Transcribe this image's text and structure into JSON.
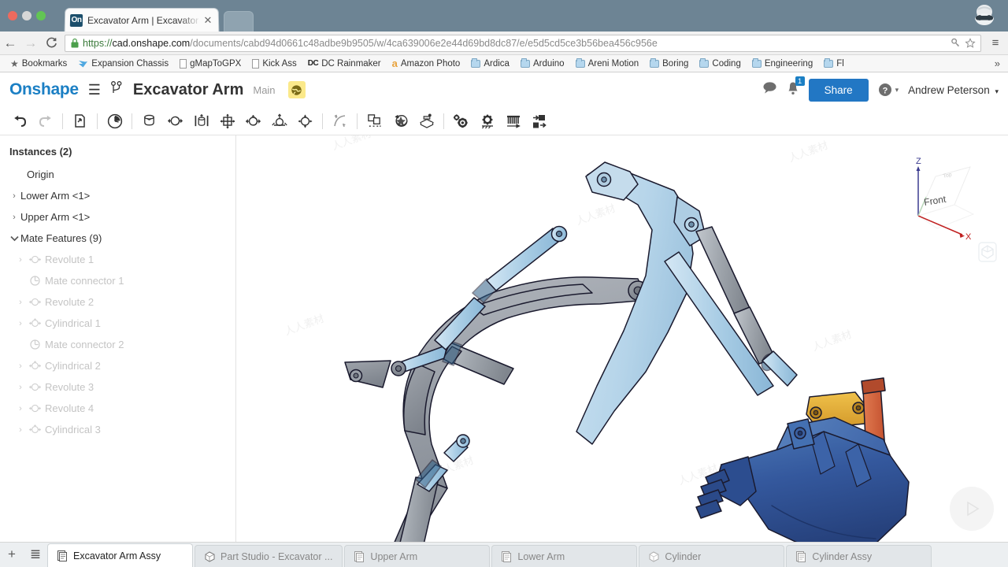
{
  "browser": {
    "tab_title": "Excavator Arm | Excavator",
    "tab_favicon_text": "On",
    "url_scheme": "https://",
    "url_host": "cad.onshape.com",
    "url_path": "/documents/cabd94d0661c48adbe9b9505/w/4ca639006e2e44d69bd8dc87/e/e5d5cd5ce3b56bea456c956e",
    "back_label": "←",
    "forward_label": "→",
    "reload_label": "C",
    "menu_label": "≡",
    "overflow_label": "»",
    "bookmarks": [
      {
        "label": "Bookmarks",
        "icon": "star-icon"
      },
      {
        "label": "Expansion Chassis",
        "icon": "bird-icon"
      },
      {
        "label": "gMapToGPX",
        "icon": "page-icon"
      },
      {
        "label": "Kick Ass",
        "icon": "page-icon"
      },
      {
        "label": "DC Rainmaker",
        "icon": "dc-icon"
      },
      {
        "label": "Amazon Photo",
        "icon": "amazon-icon"
      },
      {
        "label": "Ardica",
        "icon": "folder-icon"
      },
      {
        "label": "Arduino",
        "icon": "folder-icon"
      },
      {
        "label": "Areni Motion",
        "icon": "folder-icon"
      },
      {
        "label": "Boring",
        "icon": "folder-icon"
      },
      {
        "label": "Coding",
        "icon": "folder-icon"
      },
      {
        "label": "Engineering",
        "icon": "folder-icon"
      },
      {
        "label": "Fl",
        "icon": "folder-icon"
      }
    ]
  },
  "header": {
    "logo": "Onshape",
    "document_title": "Excavator Arm",
    "workspace": "Main",
    "share_label": "Share",
    "user_name": "Andrew Peterson",
    "notification_count": "1",
    "help_label": "?",
    "caret": "▾"
  },
  "toolbar": {
    "items": [
      {
        "name": "undo-icon",
        "label": "Undo",
        "disabled": false
      },
      {
        "name": "redo-icon",
        "label": "Redo",
        "disabled": true
      },
      {
        "name": "insert-part-icon",
        "label": "Insert components"
      },
      {
        "name": "assembly-history-icon",
        "label": "Assembly pattern"
      },
      {
        "name": "fastened-mate-icon",
        "label": "Fastened mate"
      },
      {
        "name": "revolute-mate-icon",
        "label": "Revolute mate"
      },
      {
        "name": "slider-mate-icon",
        "label": "Slider mate"
      },
      {
        "name": "planar-mate-icon",
        "label": "Planar mate"
      },
      {
        "name": "cylindrical-mate-icon",
        "label": "Cylindrical mate"
      },
      {
        "name": "pin-slot-mate-icon",
        "label": "Pin slot mate"
      },
      {
        "name": "ball-mate-icon",
        "label": "Ball mate"
      },
      {
        "name": "mate-relation-icon",
        "label": "Mate relation"
      },
      {
        "name": "group-icon",
        "label": "Group"
      },
      {
        "name": "replicate-icon",
        "label": "Replicate"
      },
      {
        "name": "explode-icon",
        "label": "Explode view"
      },
      {
        "name": "gear-mate-icon",
        "label": "Gear relation"
      },
      {
        "name": "mate-connector-icon",
        "label": "Mate connector"
      },
      {
        "name": "comb-icon",
        "label": "Linear pattern"
      },
      {
        "name": "insert-export-icon",
        "label": "Transform"
      }
    ]
  },
  "sidebar": {
    "heading": "Instances (2)",
    "rows": [
      {
        "label": "Origin",
        "indent": 3,
        "caret": "",
        "icon": "",
        "faded": false
      },
      {
        "label": "Lower Arm <1>",
        "indent": 1,
        "caret": "›",
        "icon": "",
        "faded": false
      },
      {
        "label": "Upper Arm <1>",
        "indent": 1,
        "caret": "›",
        "icon": "",
        "faded": false
      },
      {
        "label": "Mate Features (9)",
        "indent": 1,
        "caret": "⌄",
        "icon": "",
        "faded": false
      },
      {
        "label": "Revolute 1",
        "indent": 2,
        "caret": "›",
        "icon": "revolute-mate-icon",
        "faded": true
      },
      {
        "label": "Mate connector 1",
        "indent": 2,
        "caret": "",
        "icon": "mate-connector-icon",
        "faded": true
      },
      {
        "label": "Revolute 2",
        "indent": 2,
        "caret": "›",
        "icon": "revolute-mate-icon",
        "faded": true
      },
      {
        "label": "Cylindrical 1",
        "indent": 2,
        "caret": "›",
        "icon": "cylindrical-mate-icon",
        "faded": true
      },
      {
        "label": "Mate connector 2",
        "indent": 2,
        "caret": "",
        "icon": "mate-connector-icon",
        "faded": true
      },
      {
        "label": "Cylindrical 2",
        "indent": 2,
        "caret": "›",
        "icon": "cylindrical-mate-icon",
        "faded": true
      },
      {
        "label": "Revolute 3",
        "indent": 2,
        "caret": "›",
        "icon": "revolute-mate-icon",
        "faded": true
      },
      {
        "label": "Revolute 4",
        "indent": 2,
        "caret": "›",
        "icon": "revolute-mate-icon",
        "faded": true
      },
      {
        "label": "Cylindrical 3",
        "indent": 2,
        "caret": "›",
        "icon": "cylindrical-mate-icon",
        "faded": true
      }
    ]
  },
  "viewport": {
    "viewcube": {
      "axis_z": "Z",
      "axis_x": "X",
      "face_front": "Front",
      "face_top": "Top"
    },
    "model_name": "excavator-arm-assembly",
    "colors": {
      "arm_gray": "#9a9ea6",
      "arm_light_blue": "#b6d4e8",
      "cylinder_blue": "#a9cfe6",
      "bucket_blue": "#2f5a9e",
      "link_yellow": "#e0a82e",
      "link_orange": "#d4603a",
      "outline": "#1a1a2e"
    },
    "watermark_text": "人人素材"
  },
  "bottom_tabs": {
    "add_label": "+",
    "list_label": "≣",
    "tabs": [
      {
        "label": "Excavator Arm Assy",
        "icon": "assembly-icon",
        "active": true
      },
      {
        "label": "Part Studio - Excavator ...",
        "icon": "partstudio-icon",
        "active": false
      },
      {
        "label": "Upper Arm",
        "icon": "assembly-icon",
        "active": false
      },
      {
        "label": "Lower Arm",
        "icon": "assembly-icon",
        "active": false
      },
      {
        "label": "Cylinder",
        "icon": "partstudio-icon",
        "active": false
      },
      {
        "label": "Cylinder Assy",
        "icon": "assembly-icon",
        "active": false
      }
    ]
  }
}
